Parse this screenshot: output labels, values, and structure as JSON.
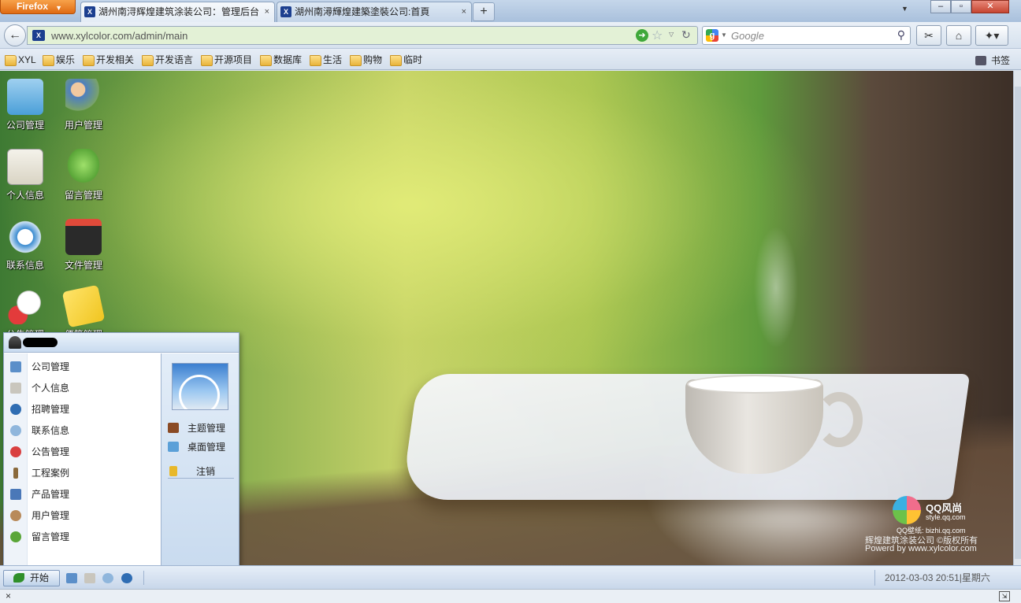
{
  "browser": {
    "menu_button": "Firefox",
    "tabs": [
      {
        "title": "湖州南浔辉煌建筑涂装公司：管理后台",
        "favicon": "site-logo"
      },
      {
        "title": "湖州南潯輝煌建築塗裝公司:首頁",
        "favicon": "site-logo"
      }
    ],
    "new_tab": "+",
    "close_tab": "×",
    "url": "www.xylcolor.com/admin/main",
    "search_placeholder": "Google",
    "favicon_text": "X",
    "window_buttons": {
      "minimize": "–",
      "maximize": "▫",
      "close": "✕"
    }
  },
  "bookmarks": {
    "items": [
      "XYL",
      "娱乐",
      "开发相关",
      "开发语言",
      "开源项目",
      "数据库",
      "生活",
      "购物",
      "临时"
    ],
    "right_label": "书签"
  },
  "desktop": {
    "icons": [
      {
        "label": "公司管理",
        "icon": "company-building-icon",
        "color": "#4a9fd8"
      },
      {
        "label": "用户管理",
        "icon": "users-icon",
        "color": "#b88a5a"
      },
      {
        "label": "个人信息",
        "icon": "id-card-icon",
        "color": "#d9d4c4"
      },
      {
        "label": "留言管理",
        "icon": "message-bubble-icon",
        "color": "#5aa638"
      },
      {
        "label": "联系信息",
        "icon": "at-sign-icon",
        "color": "#3a8bd0"
      },
      {
        "label": "文件管理",
        "icon": "folder-icon",
        "color": "#2a2a2a"
      },
      {
        "label": "公告管理",
        "icon": "announcement-icon",
        "color": "#e33b3b"
      },
      {
        "label": "便签管理",
        "icon": "sticky-note-icon",
        "color": "#f0c520"
      }
    ],
    "watermark": {
      "brand": "QQ风尚",
      "site": "style.qq.com",
      "line1": "QQ壁纸: bizhi.qq.com",
      "line2": "辉煌建筑涂装公司 ©版权所有",
      "line3": "Powerd by www.xylcolor.com"
    }
  },
  "start_menu": {
    "left_items": [
      {
        "label": "公司管理",
        "color": "#5b8fc9"
      },
      {
        "label": "个人信息",
        "color": "#c9c6bd"
      },
      {
        "label": "招聘管理",
        "color": "#2f6db3"
      },
      {
        "label": "联系信息",
        "color": "#8fb6dc"
      },
      {
        "label": "公告管理",
        "color": "#d94040"
      },
      {
        "label": "工程案例",
        "color": "#8a6a3c"
      },
      {
        "label": "产品管理",
        "color": "#4a78b8"
      },
      {
        "label": "用户管理",
        "color": "#b88a5a"
      },
      {
        "label": "留言管理",
        "color": "#5aa638"
      }
    ],
    "right_items": [
      {
        "label": "主题管理",
        "color": "#8a4a24"
      },
      {
        "label": "桌面管理",
        "color": "#5ba0d8"
      },
      {
        "label": "注销",
        "color": "#e8b82a"
      }
    ]
  },
  "taskbar": {
    "start_label": "开始",
    "quick_icons": [
      "company-icon",
      "id-card-icon",
      "contact-icon",
      "recruit-icon"
    ],
    "datetime": "2012-03-03 20:51|星期六"
  },
  "statusbar": {
    "close": "×"
  }
}
